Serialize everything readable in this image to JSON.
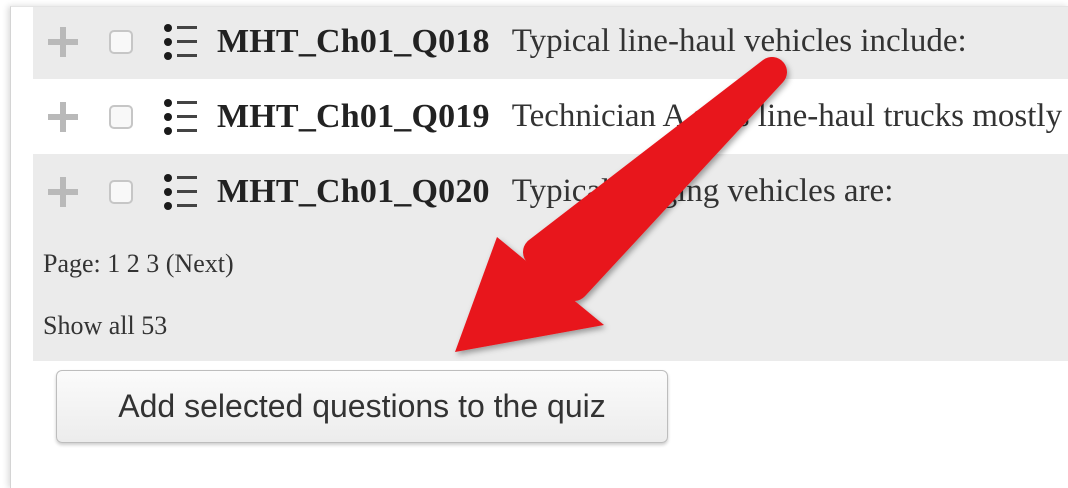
{
  "questions": [
    {
      "name": "MHT_Ch01_Q018",
      "text": "Typical line-haul vehicles include:"
    },
    {
      "name": "MHT_Ch01_Q019",
      "text": "Technician A says line-haul trucks mostly"
    },
    {
      "name": "MHT_Ch01_Q020",
      "text": "Typical logging vehicles are:"
    }
  ],
  "paging": {
    "label": "Page:",
    "pages": [
      "1",
      "2",
      "3"
    ],
    "next": "(Next)",
    "show_all": "Show all 53"
  },
  "add_button": {
    "label": "Add selected questions to the quiz"
  },
  "colors": {
    "row_shade": "#ebebeb",
    "arrow": "#e8141b"
  },
  "icons": [
    "add-plus-icon",
    "question-list-icon",
    "annotation-arrow"
  ]
}
